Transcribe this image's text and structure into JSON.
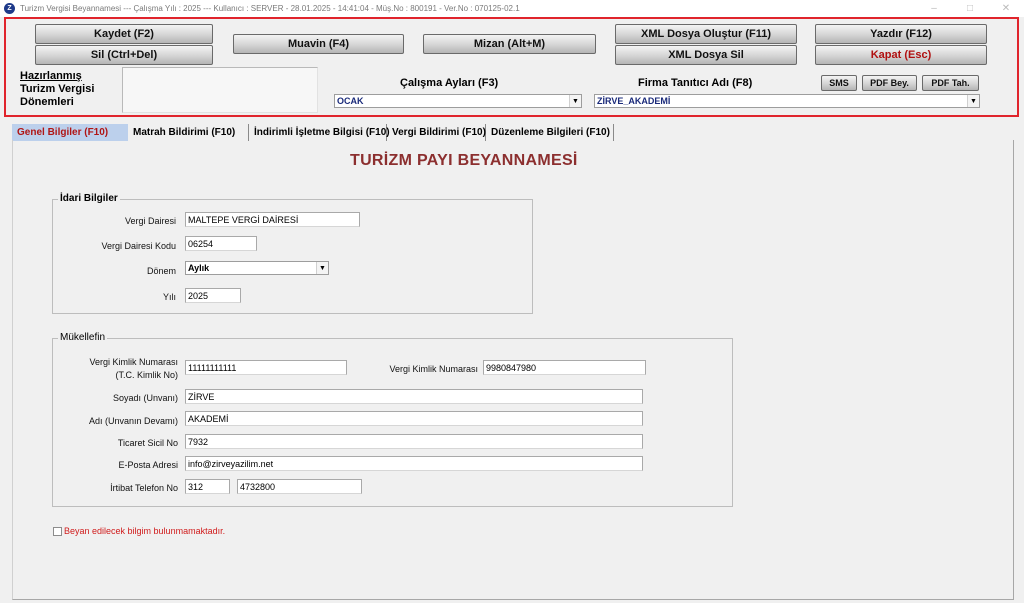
{
  "titlebar": {
    "text": "Turizm Vergisi Beyannamesi  ---  Çalışma Yılı : 2025  ---  Kullanıcı : SERVER - 28.01.2025 - 14:41:04 - Müş.No : 800191 - Ver.No : 070125-02.1",
    "minimize": "–",
    "maximize": "□",
    "close": "✕"
  },
  "toolbar": {
    "kaydet": "Kaydet (F2)",
    "sil": "Sil (Ctrl+Del)",
    "muavin": "Muavin (F4)",
    "mizan": "Mizan (Alt+M)",
    "xml_olustur": "XML Dosya Oluştur (F11)",
    "xml_sil": "XML Dosya Sil",
    "yazdir": "Yazdır (F12)",
    "kapat": "Kapat (Esc)",
    "sms": "SMS",
    "pdf_bey": "PDF Bey.",
    "pdf_tah": "PDF Tah."
  },
  "header": {
    "prepared_label_1": "Hazırlanmış",
    "prepared_label_2": "Turizm Vergisi",
    "prepared_label_3": "Dönemleri",
    "calisma_aylari_label": "Çalışma Ayları (F3)",
    "calisma_aylari_value": "OCAK",
    "firma_label": "Firma Tanıtıcı Adı (F8)",
    "firma_value": "ZİRVE_AKADEMİ"
  },
  "tabs": [
    {
      "label": "Genel Bilgiler (F10)"
    },
    {
      "label": "Matrah Bildirimi (F10)"
    },
    {
      "label": "İndirimli İşletme Bilgisi (F10)"
    },
    {
      "label": "Vergi Bildirimi (F10)"
    },
    {
      "label": "Düzenleme Bilgileri (F10)"
    }
  ],
  "page_title": "TURİZM PAYI BEYANNAMESİ",
  "idari": {
    "title": "İdari Bilgiler",
    "vergi_dairesi_label": "Vergi Dairesi",
    "vergi_dairesi_value": "MALTEPE VERGİ DAİRESİ",
    "vd_kodu_label": "Vergi Dairesi Kodu",
    "vd_kodu_value": "06254",
    "donem_label": "Dönem",
    "donem_value": "Aylık",
    "yil_label": "Yılı",
    "yil_value": "2025"
  },
  "mukellef": {
    "title": "Mükellefin",
    "vkn_label_1": "Vergi Kimlik Numarası",
    "vkn_label_2": "(T.C. Kimlik No)",
    "vkn_value": "11111111111",
    "vkn2_label": "Vergi Kimlik Numarası",
    "vkn2_value": "9980847980",
    "soyadi_label": "Soyadı (Unvanı)",
    "soyadi_value": "ZİRVE",
    "adi_label": "Adı (Unvanın Devamı)",
    "adi_value": "AKADEMİ",
    "ticaret_label": "Ticaret Sicil No",
    "ticaret_value": "7932",
    "eposta_label": "E-Posta Adresi",
    "eposta_value": "info@zirveyazilim.net",
    "tel_label": "İrtibat Telefon No",
    "tel_alan": "312",
    "tel_no": "4732800"
  },
  "footer": {
    "checkbox_label": "Beyan edilecek bilgim bulunmamaktadır."
  }
}
